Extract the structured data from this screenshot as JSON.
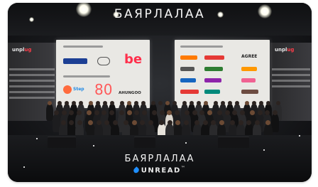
{
  "header": {
    "title": "БАЯРЛАЛАА"
  },
  "sponsor_boards": {
    "left": {
      "logos": [
        {
          "name": "xacbank-logo",
          "text": "XAC BANK",
          "color": "#1c3f94"
        },
        {
          "name": "partner-round-logo",
          "text": "",
          "color": "#3a3a3a"
        },
        {
          "name": "be-logo",
          "text": "be",
          "color": "#ff2f4b"
        },
        {
          "name": "step-logo",
          "text": "Step",
          "color": "#1e88e5"
        },
        {
          "name": "eighty-logo",
          "text": "80",
          "color": "#ff5a5a"
        },
        {
          "name": "ahunggo-logo",
          "text": "АНUNGOO",
          "color": "#2a2a2a"
        }
      ]
    },
    "right": {
      "logos": [
        {
          "name": "mobicom-logo",
          "text": "mobicom",
          "color": "#ff2f4b"
        },
        {
          "name": "unread-wordmark-logo",
          "text": "",
          "color": "#ff7a00"
        },
        {
          "name": "agree-logo",
          "text": "AGREE",
          "color": "#222222"
        }
      ]
    }
  },
  "footer": {
    "title": "БАЯРЛАЛАА",
    "brand": "UNREAD",
    "trademark": "™"
  },
  "colors": {
    "accent_red": "#ff2f4b",
    "accent_blue": "#1f8fff",
    "stage_dark": "#17181b"
  }
}
